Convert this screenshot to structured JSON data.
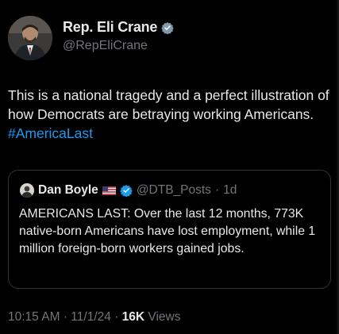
{
  "author": {
    "display_name": "Rep. Eli Crane",
    "handle": "@RepEliCrane",
    "verified_icon": "verified-gray-badge-icon"
  },
  "tweet": {
    "text": "This is a national tragedy and a perfect illustration of how Democrats are betraying working Americans. ",
    "hashtag": "#AmericaLast"
  },
  "quoted": {
    "display_name": "Dan Boyle",
    "flag_icon": "us-flag-icon",
    "verified_icon": "verified-blue-badge-icon",
    "handle": "@DTB_Posts",
    "separator": "·",
    "age": "1d",
    "text": "AMERICANS LAST: Over the last 12 months, 773K native-born Americans have lost employment, while 1 million foreign-born workers gained jobs."
  },
  "meta": {
    "time": "10:15 AM",
    "date": "11/1/24",
    "separator": "·",
    "views_count": "16K",
    "views_label": "Views"
  },
  "colors": {
    "background": "#000000",
    "text": "#e7e9ea",
    "muted": "#71767b",
    "link": "#1d9bf0",
    "border": "#2f3336"
  }
}
